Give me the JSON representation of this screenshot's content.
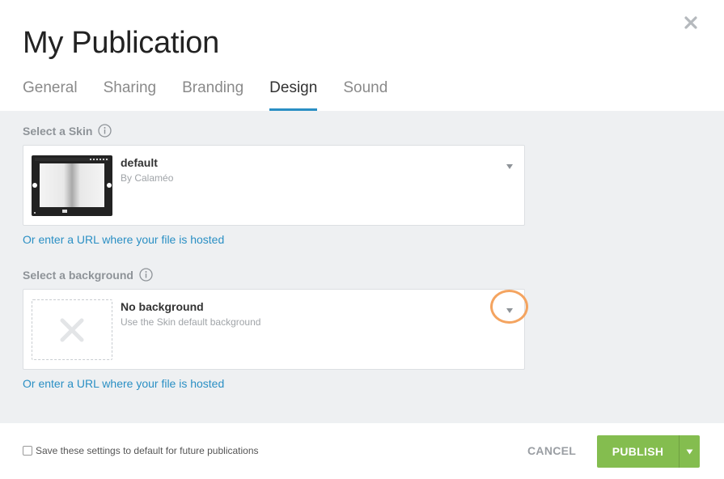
{
  "modal": {
    "title": "My Publication",
    "close_icon": "close-icon"
  },
  "tabs": [
    {
      "label": "General",
      "active": false
    },
    {
      "label": "Sharing",
      "active": false
    },
    {
      "label": "Branding",
      "active": false
    },
    {
      "label": "Design",
      "active": true
    },
    {
      "label": "Sound",
      "active": false
    }
  ],
  "skin": {
    "section_label": "Select a Skin",
    "selected_title": "default",
    "selected_subtitle": "By Calaméo",
    "url_link": "Or enter a URL where your file is hosted"
  },
  "background": {
    "section_label": "Select a background",
    "selected_title": "No background",
    "selected_subtitle": "Use the Skin default background",
    "url_link": "Or enter a URL where your file is hosted"
  },
  "footer": {
    "checkbox_label": "Save these settings to default for future publications",
    "checkbox_checked": false,
    "cancel_label": "CANCEL",
    "publish_label": "PUBLISH"
  },
  "colors": {
    "accent_blue": "#2a8fc4",
    "publish_green": "#84bd4f",
    "highlight_ring": "#f4a460",
    "panel_bg": "#eef0f2"
  }
}
